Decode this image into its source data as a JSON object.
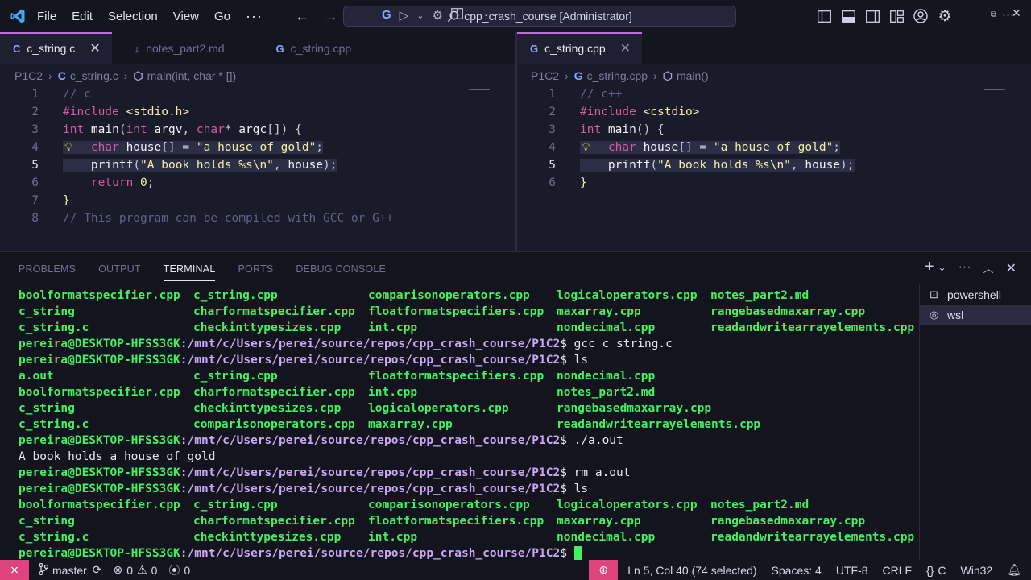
{
  "titlebar": {
    "menus": [
      "File",
      "Edit",
      "Selection",
      "View",
      "Go"
    ],
    "more": "···",
    "search_text": "cpp_crash_course [Administrator]"
  },
  "left_editor": {
    "tabs": [
      {
        "icon": "C",
        "label": "c_string.c",
        "active": true
      },
      {
        "icon": "↓",
        "label": "notes_part2.md",
        "active": false
      },
      {
        "icon": "G",
        "label": "c_string.cpp",
        "active": false
      }
    ],
    "breadcrumb": [
      "P1C2",
      "c_string.c",
      "main(int, char * [])"
    ],
    "lines": [
      {
        "n": "1",
        "parts": [
          [
            "cm",
            "// c"
          ]
        ]
      },
      {
        "n": "2",
        "parts": [
          [
            "pp",
            "#include "
          ],
          [
            "str",
            "<stdio.h>"
          ]
        ]
      },
      {
        "n": "3",
        "parts": [
          [
            "kw",
            "int "
          ],
          [
            "fn",
            "main"
          ],
          [
            "punc",
            "("
          ],
          [
            "kw",
            "int "
          ],
          [
            "fn",
            "argv"
          ],
          [
            "punc",
            ", "
          ],
          [
            "kw",
            "char"
          ],
          [
            "punc",
            "* "
          ],
          [
            "fn",
            "argc"
          ],
          [
            "punc",
            "[]) {"
          ]
        ]
      },
      {
        "n": "4",
        "parts": [
          [
            "punc",
            "    "
          ],
          [
            "kw",
            "char "
          ],
          [
            "fn",
            "house"
          ],
          [
            "punc",
            "[] = "
          ],
          [
            "str",
            "\"a house of gold\""
          ],
          [
            "punc",
            ";"
          ]
        ]
      },
      {
        "n": "5",
        "parts": [
          [
            "punc",
            "    "
          ],
          [
            "fn",
            "printf"
          ],
          [
            "punc",
            "("
          ],
          [
            "str",
            "\"A book holds %s\\n\""
          ],
          [
            "punc",
            ", "
          ],
          [
            "fn",
            "house"
          ],
          [
            "punc",
            ");"
          ]
        ]
      },
      {
        "n": "6",
        "parts": [
          [
            "punc",
            "    "
          ],
          [
            "kw",
            "return "
          ],
          [
            "num",
            "0"
          ],
          [
            "punc",
            ";"
          ]
        ]
      },
      {
        "n": "7",
        "parts": [
          [
            "str",
            "}"
          ]
        ]
      },
      {
        "n": "8",
        "parts": [
          [
            "cm",
            "// This program can be compiled with GCC or G++"
          ]
        ]
      }
    ]
  },
  "right_editor": {
    "tabs": [
      {
        "icon": "G",
        "label": "c_string.cpp",
        "active": true
      }
    ],
    "breadcrumb": [
      "P1C2",
      "c_string.cpp",
      "main()"
    ],
    "lines": [
      {
        "n": "1",
        "parts": [
          [
            "cm",
            "// c++"
          ]
        ]
      },
      {
        "n": "2",
        "parts": [
          [
            "pp",
            "#include "
          ],
          [
            "str",
            "<cstdio>"
          ]
        ]
      },
      {
        "n": "3",
        "parts": [
          [
            "kw",
            "int "
          ],
          [
            "fn",
            "main"
          ],
          [
            "punc",
            "() {"
          ]
        ]
      },
      {
        "n": "4",
        "parts": [
          [
            "punc",
            "    "
          ],
          [
            "kw",
            "char "
          ],
          [
            "fn",
            "house"
          ],
          [
            "punc",
            "[] = "
          ],
          [
            "str",
            "\"a house of gold\""
          ],
          [
            "punc",
            ";"
          ]
        ]
      },
      {
        "n": "5",
        "parts": [
          [
            "punc",
            "    "
          ],
          [
            "fn",
            "printf"
          ],
          [
            "punc",
            "("
          ],
          [
            "str",
            "\"A book holds %s\\n\""
          ],
          [
            "punc",
            ", "
          ],
          [
            "fn",
            "house"
          ],
          [
            "punc",
            ");"
          ]
        ]
      },
      {
        "n": "6",
        "parts": [
          [
            "str",
            "}"
          ]
        ]
      }
    ]
  },
  "panel": {
    "tabs": [
      "PROBLEMS",
      "OUTPUT",
      "TERMINAL",
      "PORTS",
      "DEBUG CONSOLE"
    ],
    "active_tab": "TERMINAL",
    "terminals": [
      "powershell",
      "wsl"
    ],
    "prompt": "pereira@DESKTOP-HFSS3GK",
    "path": ":/mnt/c/Users/perei/source/repos/cpp_crash_course/P1C2",
    "lines": [
      {
        "type": "ls",
        "cols": [
          "boolformatspecifier.cpp",
          "c_string.cpp",
          "comparisonoperators.cpp",
          "logicaloperators.cpp",
          "notes_part2.md"
        ],
        "widths": [
          217,
          217,
          234,
          191,
          0
        ]
      },
      {
        "type": "ls",
        "cols": [
          "c_string",
          "charformatspecifier.cpp",
          "floatformatspecifiers.cpp",
          "maxarray.cpp",
          "rangebasedmaxarray.cpp"
        ],
        "widths": [
          217,
          217,
          234,
          191,
          0
        ]
      },
      {
        "type": "ls",
        "cols": [
          "c_string.c",
          "checkinttypesizes.cpp",
          "int.cpp",
          "nondecimal.cpp",
          "readandwritearrayelements.cpp"
        ],
        "widths": [
          217,
          217,
          234,
          191,
          0
        ]
      },
      {
        "type": "cmd",
        "cmd": "$ gcc c_string.c"
      },
      {
        "type": "cmd",
        "cmd": "$ ls"
      },
      {
        "type": "ls",
        "cols": [
          "a.out",
          "c_string.cpp",
          "floatformatspecifiers.cpp",
          "nondecimal.cpp"
        ],
        "widths": [
          217,
          217,
          234,
          0
        ]
      },
      {
        "type": "ls",
        "cols": [
          "boolformatspecifier.cpp",
          "charformatspecifier.cpp",
          "int.cpp",
          "notes_part2.md"
        ],
        "widths": [
          217,
          217,
          234,
          0
        ]
      },
      {
        "type": "ls",
        "cols": [
          "c_string",
          "checkinttypesizes.cpp",
          "logicaloperators.cpp",
          "rangebasedmaxarray.cpp"
        ],
        "widths": [
          217,
          217,
          234,
          0
        ]
      },
      {
        "type": "ls",
        "cols": [
          "c_string.c",
          "comparisonoperators.cpp",
          "maxarray.cpp",
          "readandwritearrayelements.cpp"
        ],
        "widths": [
          217,
          217,
          234,
          0
        ]
      },
      {
        "type": "cmd",
        "cmd": "$ ./a.out"
      },
      {
        "type": "out",
        "text": "A book holds a house of gold"
      },
      {
        "type": "cmd",
        "cmd": "$ rm a.out"
      },
      {
        "type": "cmd",
        "cmd": "$ ls"
      },
      {
        "type": "ls",
        "cols": [
          "boolformatspecifier.cpp",
          "c_string.cpp",
          "comparisonoperators.cpp",
          "logicaloperators.cpp",
          "notes_part2.md"
        ],
        "widths": [
          217,
          217,
          234,
          191,
          0
        ]
      },
      {
        "type": "ls",
        "cols": [
          "c_string",
          "charformatspecifier.cpp",
          "floatformatspecifiers.cpp",
          "maxarray.cpp",
          "rangebasedmaxarray.cpp"
        ],
        "widths": [
          217,
          217,
          234,
          191,
          0
        ]
      },
      {
        "type": "ls",
        "cols": [
          "c_string.c",
          "checkinttypesizes.cpp",
          "int.cpp",
          "nondecimal.cpp",
          "readandwritearrayelements.cpp"
        ],
        "widths": [
          217,
          217,
          234,
          191,
          0
        ]
      },
      {
        "type": "prompt",
        "cmd": "$ "
      }
    ]
  },
  "statusbar": {
    "branch": "master",
    "errors": "0",
    "warnings": "0",
    "ports": "0",
    "position": "Ln 5, Col 40 (74 selected)",
    "spaces": "Spaces: 4",
    "encoding": "UTF-8",
    "eol": "CRLF",
    "language": "C",
    "language_prefix": "{}",
    "platform": "Win32"
  },
  "colors": {
    "accent": "#c06be0",
    "terminal_green": "#41f15d",
    "terminal_path": "#c9a7f5",
    "remote_badge": "#e0447d"
  }
}
